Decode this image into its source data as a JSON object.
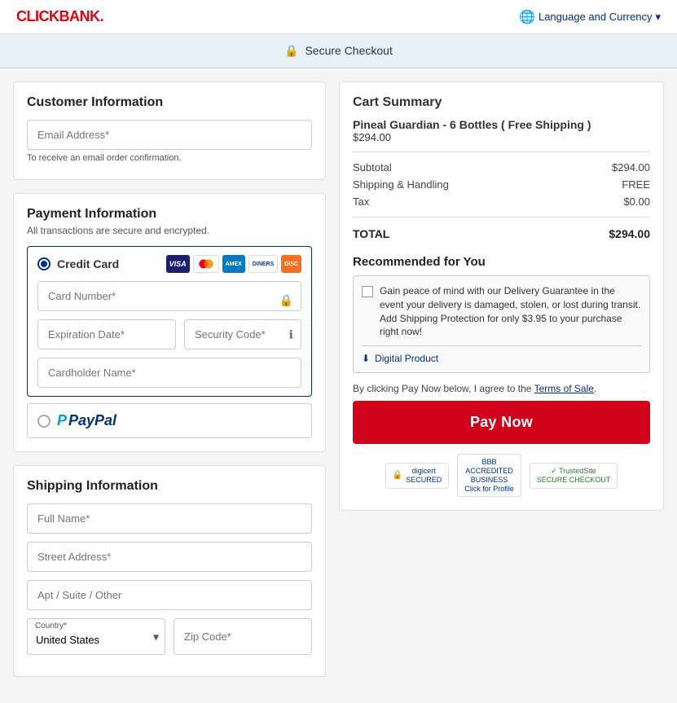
{
  "header": {
    "logo_text": "CLICKBANK.",
    "lang_currency_label": "Language and Currency"
  },
  "banner": {
    "secure_text": "Secure Checkout"
  },
  "customer_info": {
    "section_title": "Customer Information",
    "email_label": "Email Address*",
    "email_placeholder": "Email Address*",
    "email_hint": "To receive an email order confirmation."
  },
  "payment_info": {
    "section_title": "Payment Information",
    "section_subtitle": "All transactions are secure and encrypted.",
    "credit_card_label": "Credit Card",
    "card_number_placeholder": "Card Number*",
    "expiry_placeholder": "Expiration Date*",
    "security_placeholder": "Security Code*",
    "cardholder_placeholder": "Cardholder Name*",
    "paypal_label": "PayPal"
  },
  "shipping_info": {
    "section_title": "Shipping Information",
    "full_name_placeholder": "Full Name*",
    "street_placeholder": "Street Address*",
    "apt_placeholder": "Apt / Suite / Other",
    "country_label": "Country*",
    "country_value": "United States",
    "zip_placeholder": "Zip Code*"
  },
  "cart": {
    "title": "Cart Summary",
    "product_name": "Pineal Guardian - 6 Bottles ( Free Shipping )",
    "product_price": "$294.00",
    "subtotal_label": "Subtotal",
    "subtotal_value": "$294.00",
    "shipping_label": "Shipping & Handling",
    "shipping_value": "FREE",
    "tax_label": "Tax",
    "tax_value": "$0.00",
    "total_label": "TOTAL",
    "total_value": "$294.00"
  },
  "recommended": {
    "title": "Recommended for You",
    "description": "Gain peace of mind with our Delivery Guarantee in the event your delivery is damaged, stolen, or lost during transit. Add Shipping Protection for only $3.95 to your purchase right now!",
    "digital_product": "Digital Product"
  },
  "terms": {
    "text_before": "By clicking Pay Now below, I agree to the ",
    "link_text": "Terms of Sale",
    "text_after": "."
  },
  "pay_now": {
    "label": "Pay Now"
  },
  "trust": {
    "digicert_label": "digicert SECURED",
    "bbb_label": "BBB ACCREDITED BUSINESS Click for Profile",
    "trusted_label": "TrustedSite SECURE CHECKOUT"
  }
}
